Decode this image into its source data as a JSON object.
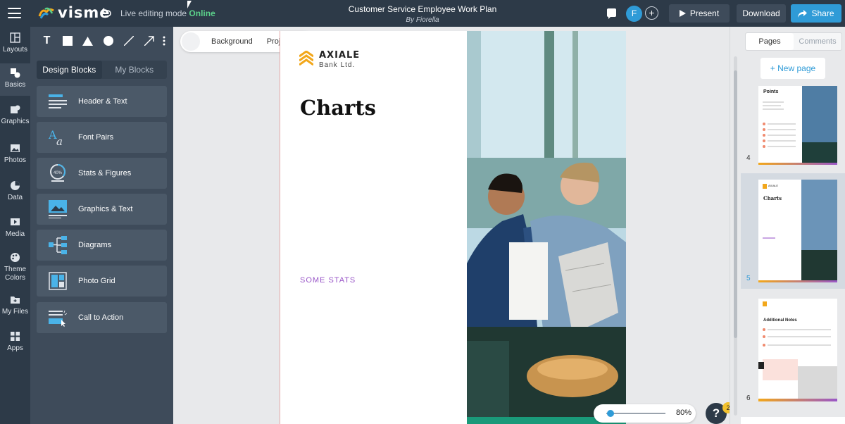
{
  "app": {
    "logo_text": "visme",
    "live_prefix": "Live editing mode",
    "live_status": "Online",
    "doc_title": "Customer Service Employee Work Plan",
    "doc_author": "By Fiorella",
    "avatar_letter": "F",
    "add_user_symbol": "+",
    "present_label": "Present",
    "download_label": "Download",
    "share_label": "Share"
  },
  "leftnav": {
    "items": [
      {
        "label": "Layouts",
        "icon": "layouts-icon"
      },
      {
        "label": "Basics",
        "icon": "basics-icon"
      },
      {
        "label": "Graphics",
        "icon": "graphics-icon"
      },
      {
        "label": "Photos",
        "icon": "photos-icon"
      },
      {
        "label": "Data",
        "icon": "data-icon"
      },
      {
        "label": "Media",
        "icon": "media-icon"
      },
      {
        "label": "Theme Colors",
        "icon": "palette-icon"
      },
      {
        "label": "My Files",
        "icon": "my-files-icon"
      },
      {
        "label": "Apps",
        "icon": "apps-icon"
      }
    ]
  },
  "panel": {
    "tools": [
      "text-tool",
      "rectangle-tool",
      "triangle-tool",
      "circle-tool",
      "line-tool",
      "arrow-tool",
      "more-tool"
    ],
    "text_tool_label": "T",
    "tabs": [
      "Design Blocks",
      "My Blocks"
    ],
    "blocks": [
      {
        "label": "Header & Text",
        "icon": "header-text-icon"
      },
      {
        "label": "Font Pairs",
        "icon": "font-pairs-icon"
      },
      {
        "label": "Stats & Figures",
        "icon": "stats-figures-icon"
      },
      {
        "label": "Graphics & Text",
        "icon": "graphics-text-icon"
      },
      {
        "label": "Diagrams",
        "icon": "diagrams-icon"
      },
      {
        "label": "Photo Grid",
        "icon": "photo-grid-icon"
      },
      {
        "label": "Call to Action",
        "icon": "call-to-action-icon"
      }
    ],
    "stats_icon_text": "40%"
  },
  "canvas": {
    "context_bar": [
      "Background",
      "Project size"
    ],
    "brand_name": "AXIALE",
    "brand_sub": "Bank Ltd.",
    "heading": "Charts",
    "stats_label": "SOME STATS",
    "zoom_value": "80%",
    "zoom_level": 0.05,
    "help_symbol": "?",
    "help_badge": "2"
  },
  "right_panel": {
    "tabs": [
      "Pages",
      "Comments"
    ],
    "new_page_label": "+ New page",
    "pages": [
      {
        "number": "4",
        "title": "Points",
        "selected": false
      },
      {
        "number": "5",
        "title": "Charts",
        "selected": true
      },
      {
        "number": "6",
        "title": "Additional Notes",
        "selected": false
      }
    ]
  },
  "colors": {
    "topbar": "#2d3a48",
    "accent": "#2f9bd7",
    "online": "#5bd08a",
    "stats_purple": "#9a57c8",
    "brand_gold": "#f2a71b"
  }
}
